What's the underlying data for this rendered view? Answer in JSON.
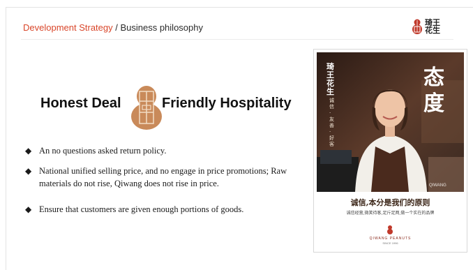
{
  "header": {
    "section": "Development Strategy",
    "separator": " / ",
    "subsection": "Business philosophy"
  },
  "logo": {
    "text": "琦王花生"
  },
  "slogan": {
    "left": "Honest Deal",
    "right": "Friendly Hospitality"
  },
  "bullets": [
    "An no questions asked return policy.",
    "National unified selling price, and no engage in price promotions; Raw materials do not rise, Qiwang does not rise in price.",
    "Ensure that customers are given enough portions of goods."
  ],
  "poster": {
    "side_brand": "琦王花生",
    "side_motto": "诚信·友善·好客",
    "big_chars": [
      "态",
      "度"
    ],
    "watermark": "QIWANG",
    "title": "诚信,本分是我们的原则",
    "subtitle": "诚信经营,微笑待客,足斤足两,做一个实在的品牌",
    "brand": "QIWANG PEANUTS",
    "since": "SINCE 1996"
  },
  "colors": {
    "accent": "#d9462a",
    "gourd": "#c98a5a",
    "apron": "#4a2a1d"
  }
}
